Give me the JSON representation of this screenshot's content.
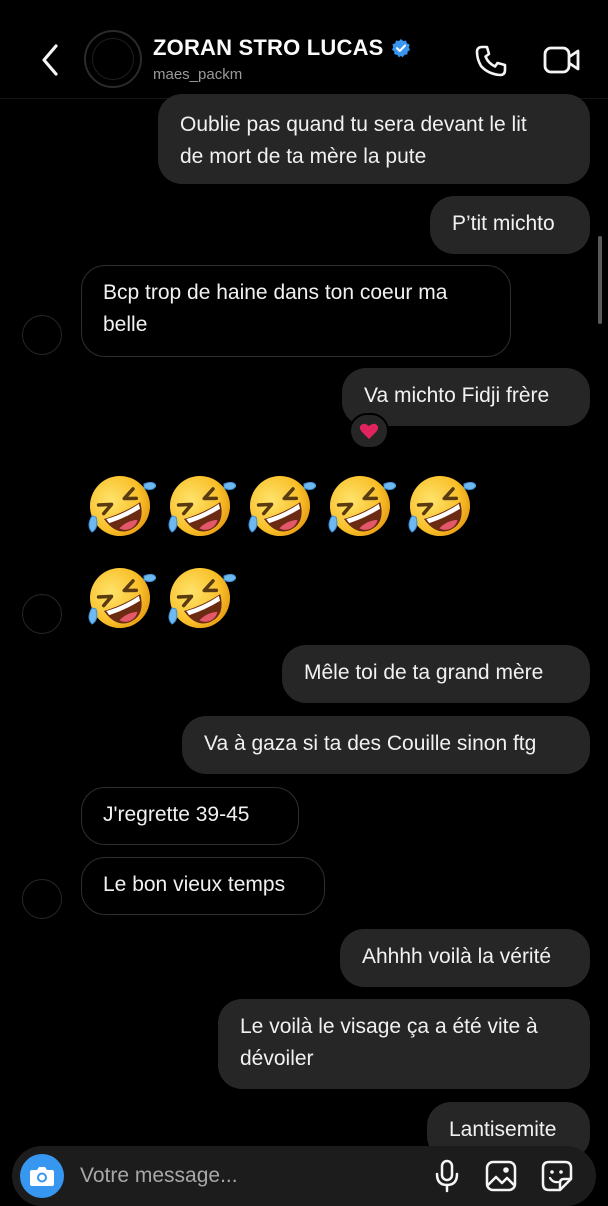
{
  "header": {
    "contact_name": "ZORAN STRO LUCAS",
    "handle": "maes_packm",
    "verified": true,
    "icons": {
      "back": "chevron-left-icon",
      "call": "phone-icon",
      "video": "video-camera-icon",
      "verified": "verified-badge-icon"
    }
  },
  "messages": [
    {
      "side": "out",
      "lines": [
        "Oublie pas quand tu sera devant le lit",
        "de mort de ta mère la pute"
      ]
    },
    {
      "side": "out",
      "lines": [
        "P’tit michto"
      ]
    },
    {
      "side": "in",
      "lines": [
        "Bcp trop de haine dans ton coeur ma",
        "belle"
      ]
    },
    {
      "side": "out",
      "lines": [
        "Va michto Fidji frère"
      ],
      "reaction": "❤️"
    },
    {
      "side": "in",
      "emoji": "rolling-on-the-floor-laughing",
      "count": 7
    },
    {
      "side": "out",
      "lines": [
        "Mêle toi de ta grand mère"
      ]
    },
    {
      "side": "out",
      "lines": [
        "Va à gaza si ta des Couille sinon ftg"
      ]
    },
    {
      "side": "in",
      "lines": [
        "J'regrette 39-45"
      ]
    },
    {
      "side": "in",
      "lines": [
        "Le bon vieux temps"
      ]
    },
    {
      "side": "out",
      "lines": [
        "Ahhhh voilà la vérité"
      ]
    },
    {
      "side": "out",
      "lines": [
        "Le voilà le visage ça a été vite à",
        "dévoiler"
      ]
    },
    {
      "side": "out",
      "lines": [
        "Lantisemite"
      ]
    }
  ],
  "composer": {
    "placeholder": "Votre message...",
    "icons": {
      "camera": "camera-icon",
      "mic": "microphone-icon",
      "gallery": "image-gallery-icon",
      "sticker": "sticker-icon"
    }
  },
  "colors": {
    "background": "#000000",
    "outgoing_bubble": "#262626",
    "incoming_border": "#2e2e2e",
    "verified": "#3797f0",
    "camera_button": "#3797f0",
    "reaction_heart": "#e0245e"
  }
}
